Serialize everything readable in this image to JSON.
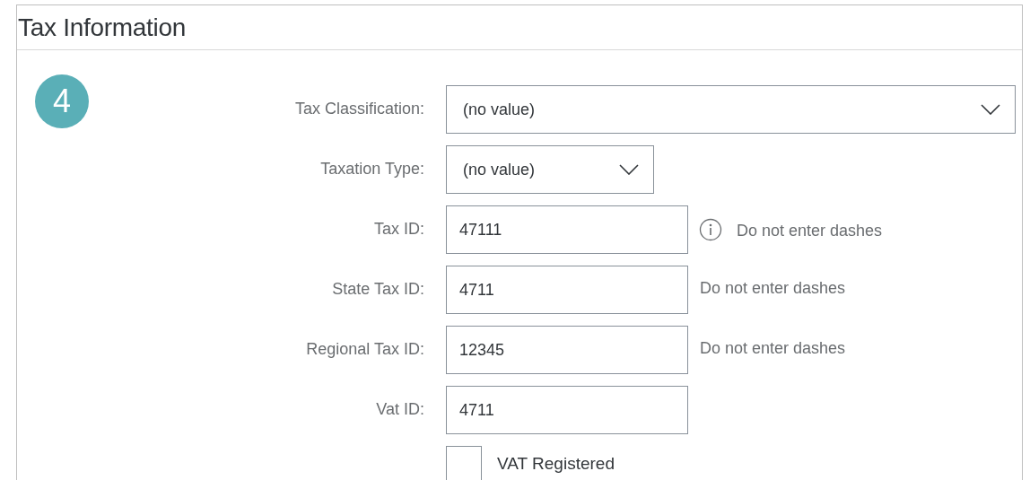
{
  "section": {
    "title": "Tax Information",
    "step": "4"
  },
  "fields": [
    {
      "kind": "select",
      "label": "Tax Classification:",
      "value": "(no value)"
    },
    {
      "kind": "select",
      "label": "Taxation Type:",
      "value": "(no value)"
    },
    {
      "kind": "input",
      "label": "Tax ID:",
      "value": "47111",
      "hint": "Do not enter dashes",
      "hint_info": true
    },
    {
      "kind": "input",
      "label": "State Tax ID:",
      "value": "4711",
      "hint": "Do not enter dashes",
      "hint_info": false
    },
    {
      "kind": "input",
      "label": "Regional Tax ID:",
      "value": "12345",
      "hint": "Do not enter dashes",
      "hint_info": false
    },
    {
      "kind": "input",
      "label": "Vat ID:",
      "value": "4711"
    },
    {
      "kind": "checkbox",
      "label": "VAT Registered",
      "checked": false
    }
  ]
}
